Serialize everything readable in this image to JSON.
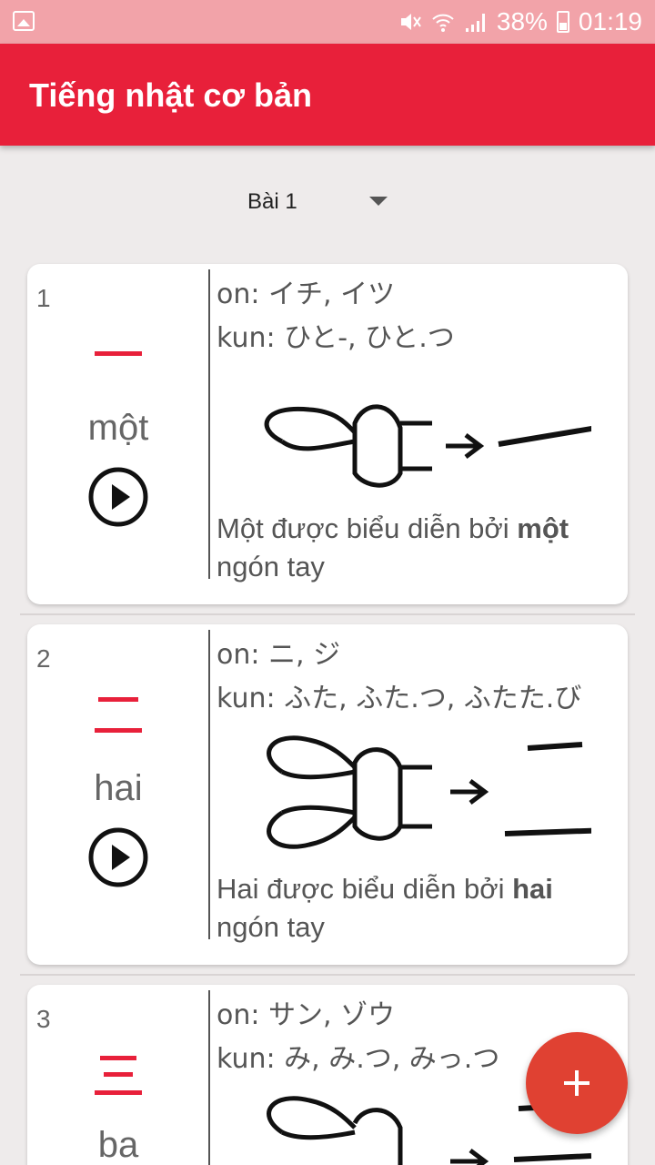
{
  "status": {
    "battery": "38%",
    "time": "01:19"
  },
  "app": {
    "title": "Tiếng nhật cơ bản"
  },
  "lesson": {
    "selected": "Bài 1"
  },
  "cards": [
    {
      "num": "1",
      "kanji": "一",
      "word": "một",
      "on": "on:  イチ, イツ",
      "kun": "kun: ひと-, ひと.つ",
      "desc_pre": "Một được biểu diễn bởi ",
      "desc_bold": "một",
      "desc_post": " ngón tay"
    },
    {
      "num": "2",
      "kanji": "二",
      "word": "hai",
      "on": "on:  ニ, ジ",
      "kun": "kun: ふた, ふた.つ, ふたた.び",
      "desc_pre": "Hai được biểu diễn bởi ",
      "desc_bold": "hai",
      "desc_post": " ngón tay"
    },
    {
      "num": "3",
      "kanji": "三",
      "word": "ba",
      "on": "on:  サン, ゾウ",
      "kun": "kun: み, み.つ, みっ.つ"
    }
  ],
  "colors": {
    "appbar": "#e8203a",
    "kanji": "#e8203a",
    "fab": "#e04132"
  },
  "icons": {
    "play": "play-circle-icon",
    "fab": "add-icon"
  }
}
